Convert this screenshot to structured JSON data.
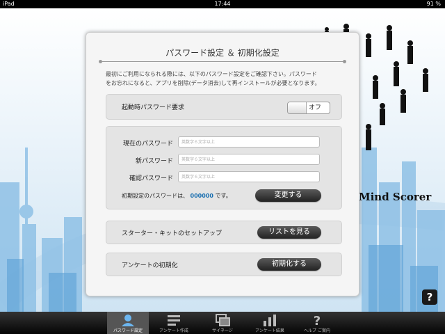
{
  "status": {
    "device": "iPad",
    "time": "17:44",
    "battery": "91 %"
  },
  "logo": "Mind Scorer",
  "help_label": "?",
  "panel": {
    "title": "パスワード設定 ＆ 初期化設定",
    "intro_line1": "最初にご利用になられる際には、以下のパスワード設定をご確認下さい。パスワード",
    "intro_line2": "をお忘れになると、アプリを削除(データ消去)して再インストールが必要となります。",
    "launch_password": {
      "label": "起動時パスワード要求",
      "toggle": "オフ"
    },
    "password_form": {
      "current_label": "現在のパスワード",
      "new_label": "新パスワード",
      "confirm_label": "確認パスワード",
      "placeholder": "英数字６文字以上",
      "note_prefix": "初期設定のパスワードは、",
      "note_code": "000000",
      "note_suffix": "です。",
      "change_button": "変更する"
    },
    "starter_kit": {
      "label": "スターター・キットのセットアップ",
      "button": "リストを見る"
    },
    "survey_reset": {
      "label": "アンケートの初期化",
      "button": "初期化する"
    }
  },
  "tabs": [
    {
      "label": "パスワード設定",
      "icon": "person-icon",
      "active": true
    },
    {
      "label": "アンケート作成",
      "icon": "edit-list-icon",
      "active": false
    },
    {
      "label": "サイネージ",
      "icon": "signage-icon",
      "active": false
    },
    {
      "label": "アンケート結果",
      "icon": "bar-chart-icon",
      "active": false
    },
    {
      "label": "ヘルプ ご案内",
      "icon": "question-icon",
      "active": false
    }
  ]
}
